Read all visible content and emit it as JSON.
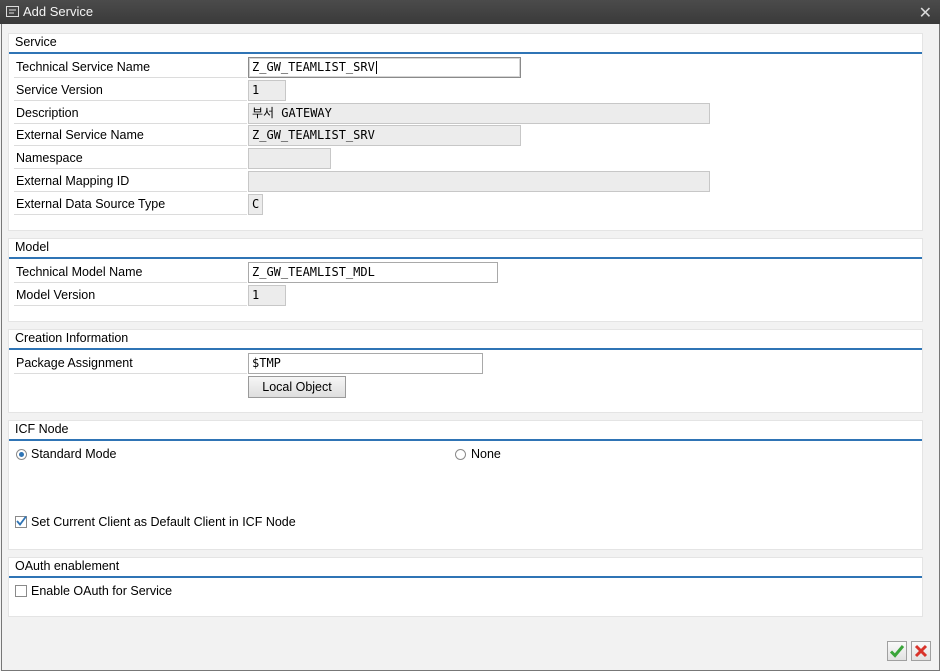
{
  "window": {
    "title": "Add Service"
  },
  "service": {
    "title": "Service",
    "fields": [
      {
        "label": "Technical Service Name",
        "value": "Z_GW_TEAMLIST_SRV"
      },
      {
        "label": "Service Version",
        "value": "1"
      },
      {
        "label": "Description",
        "value": "부서 GATEWAY"
      },
      {
        "label": "External Service Name",
        "value": "Z_GW_TEAMLIST_SRV"
      },
      {
        "label": "Namespace",
        "value": ""
      },
      {
        "label": "External Mapping ID",
        "value": ""
      },
      {
        "label": "External Data Source Type",
        "value": "C"
      }
    ]
  },
  "model": {
    "title": "Model",
    "fields": [
      {
        "label": "Technical Model Name",
        "value": "Z_GW_TEAMLIST_MDL"
      },
      {
        "label": "Model Version",
        "value": "1"
      }
    ]
  },
  "creation": {
    "title": "Creation Information",
    "package_label": "Package Assignment",
    "package_value": "$TMP",
    "local_object_button": "Local Object"
  },
  "icf": {
    "title": "ICF Node",
    "standard_mode": "Standard Mode",
    "none": "None",
    "selected": "Standard Mode",
    "default_client": "Set Current Client as Default Client in ICF Node",
    "default_client_checked": true
  },
  "oauth": {
    "title": "OAuth enablement",
    "enable_label": "Enable OAuth for Service",
    "enable_checked": false
  },
  "colors": {
    "accent": "#2f74b5",
    "titlebar": "#404040",
    "confirm": "#3aa53a",
    "cancel": "#d9342b"
  }
}
